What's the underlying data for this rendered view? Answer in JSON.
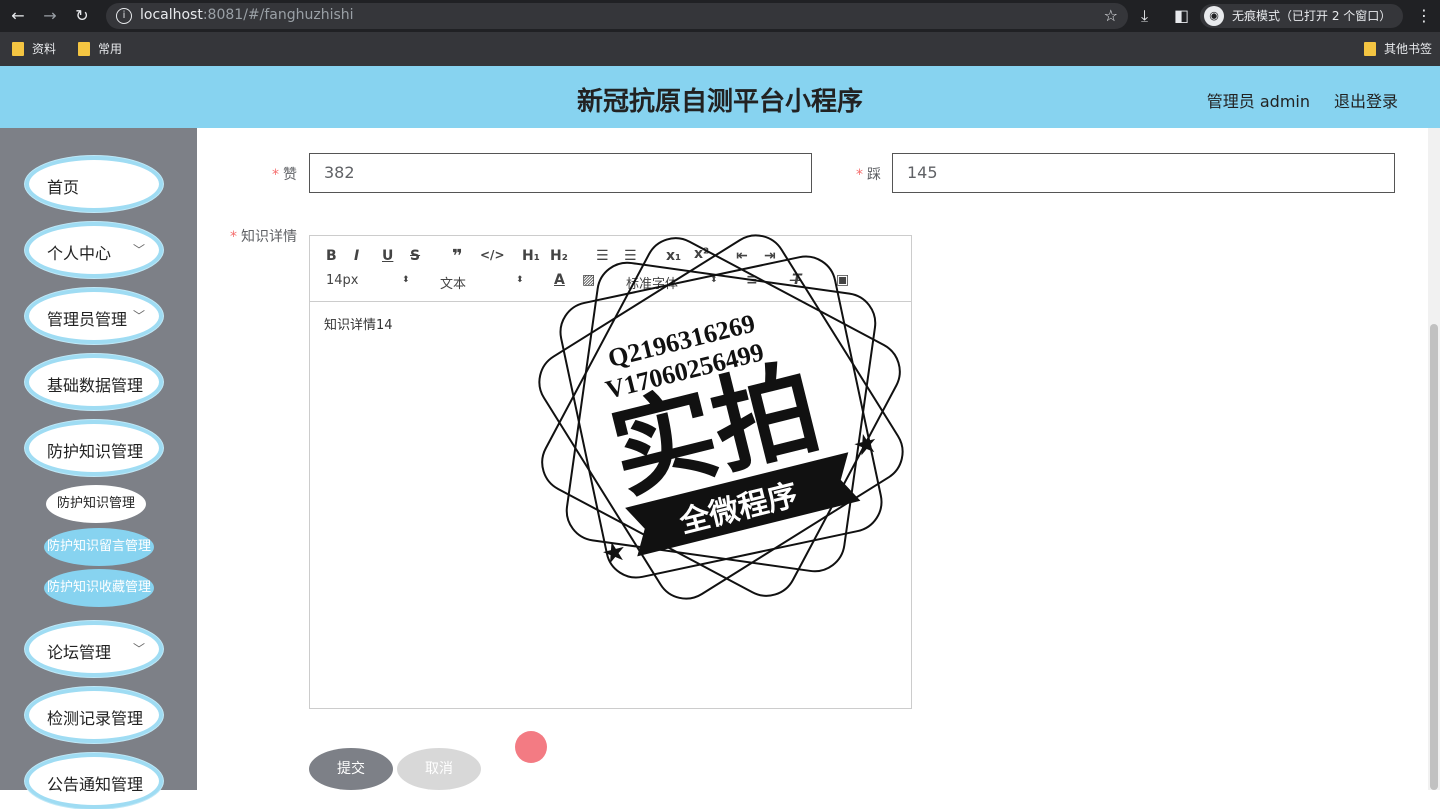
{
  "browser": {
    "url_host": "localhost",
    "url_rest": ":8081/#/fanghuzhishi",
    "incognito_label": "无痕模式（已打开 2 个窗口）",
    "bookmarks": [
      {
        "label": "资料"
      },
      {
        "label": "常用"
      }
    ],
    "other_bookmarks": "其他书签"
  },
  "header": {
    "title": "新冠抗原自测平台小程序",
    "user": "管理员 admin",
    "logout": "退出登录"
  },
  "sidebar": {
    "items": [
      {
        "label": "首页"
      },
      {
        "label": "个人中心",
        "chevron": "﹀"
      },
      {
        "label": "管理员管理",
        "chevron": "﹀"
      },
      {
        "label": "基础数据管理"
      },
      {
        "label": "防护知识管理"
      },
      {
        "label": "论坛管理",
        "chevron": "﹀"
      },
      {
        "label": "检测记录管理"
      },
      {
        "label": "公告通知管理"
      }
    ],
    "sub_items": [
      {
        "label": "防护知识管理"
      },
      {
        "label": "防护知识留言管理"
      },
      {
        "label": "防护知识收藏管理"
      }
    ]
  },
  "form": {
    "zan_label": "赞",
    "zan_value": "382",
    "cai_label": "踩",
    "cai_value": "145",
    "detail_label": "知识详情",
    "required_mark": "*",
    "editor": {
      "font_size": "14px",
      "block_type": "文本",
      "font_family": "标准字体",
      "content": "知识详情14"
    },
    "submit_label": "提交",
    "cancel_label": "取消"
  },
  "watermark": {
    "line1": "Q2196316269",
    "line2": "V17060256499",
    "main": "实拍",
    "banner": "全微程序"
  },
  "colors": {
    "header_bg": "#87d3f0",
    "sidebar_bg": "#7d8087",
    "pill_border": "#9fdcf3",
    "required": "#f56c6c"
  }
}
